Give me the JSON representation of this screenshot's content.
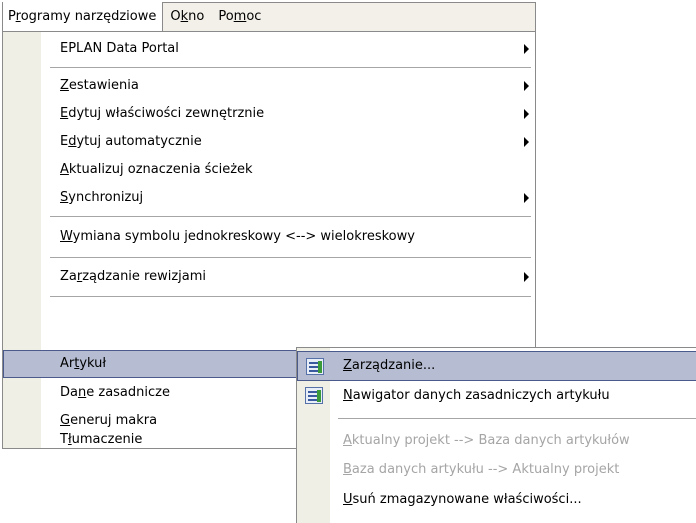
{
  "menubar": {
    "items": [
      {
        "label": "Programy narzędziowe",
        "pre": "P",
        "ul": "r",
        "post": "ogramy narzędziowe"
      },
      {
        "label": "Okno",
        "pre": "O",
        "ul": "k",
        "post": "no"
      },
      {
        "label": "Pomoc",
        "pre": "Po",
        "ul": "m",
        "post": "oc"
      }
    ]
  },
  "menu": {
    "items": [
      {
        "label": "EPLAN Data Portal",
        "pre": "EPLAN Data Portal",
        "ul": "",
        "post": ""
      },
      {
        "label": "Zestawienia",
        "pre": "",
        "ul": "Z",
        "post": "estawienia"
      },
      {
        "label": "Edytuj właściwości zewnętrznie",
        "pre": "",
        "ul": "E",
        "post": "dytuj właściwości zewnętrznie"
      },
      {
        "label": "Edytuj automatycznie",
        "pre": "E",
        "ul": "d",
        "post": "ytuj automatycznie"
      },
      {
        "label": "Aktualizuj oznaczenia ścieżek",
        "pre": "",
        "ul": "A",
        "post": "ktualizuj oznaczenia ścieżek"
      },
      {
        "label": "Synchronizuj",
        "pre": "",
        "ul": "S",
        "post": "ynchronizuj"
      },
      {
        "label": "Wymiana symbolu jednokreskowy <--> wielokreskowy",
        "pre": "",
        "ul": "W",
        "post": "ymiana symbolu jednokreskowy <--> wielokreskowy"
      },
      {
        "label": "Zarządzanie rewizjami",
        "pre": "Za",
        "ul": "r",
        "post": "ządzanie rewizjami"
      },
      {
        "label": "Artykuł",
        "pre": "Ar",
        "ul": "t",
        "post": "ykuł"
      },
      {
        "label": "Dane zasadnicze",
        "pre": "Da",
        "ul": "n",
        "post": "e zasadnicze"
      },
      {
        "label": "Generuj makra",
        "pre": "",
        "ul": "G",
        "post": "eneruj makra"
      },
      {
        "label": "Tłumaczenie",
        "pre": "T",
        "ul": "ł",
        "post": "umaczenie"
      }
    ]
  },
  "submenu": {
    "items": [
      {
        "label": "Zarządzanie...",
        "pre": "",
        "ul": "Z",
        "post": "arządzanie...",
        "icon": "article-management-icon"
      },
      {
        "label": "Nawigator danych zasadniczych artykułu",
        "pre": "",
        "ul": "N",
        "post": "awigator danych zasadniczych artykułu",
        "icon": "article-navigator-icon"
      },
      {
        "label": "Aktualny projekt --> Baza danych artykułów",
        "pre": "",
        "ul": "A",
        "post": "ktualny projekt --> Baza danych artykułów"
      },
      {
        "label": "Baza danych artykułu --> Aktualny projekt",
        "pre": "",
        "ul": "B",
        "post": "aza danych artykułu --> Aktualny projekt"
      },
      {
        "label": "Usuń zmagazynowane właściwości...",
        "pre": "",
        "ul": "U",
        "post": "suń zmagazynowane właściwości..."
      }
    ]
  }
}
